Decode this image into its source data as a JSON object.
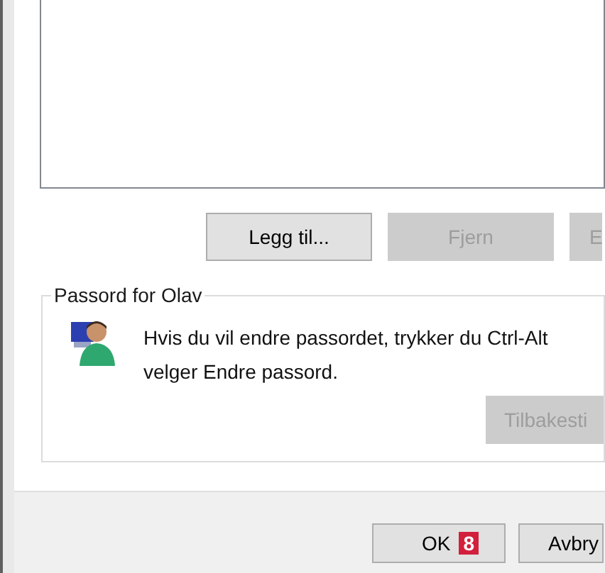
{
  "action_buttons": [
    {
      "label": "Legg til...",
      "disabled": false
    },
    {
      "label": "Fjern",
      "disabled": true
    },
    {
      "label": "E",
      "disabled": true
    }
  ],
  "password_group": {
    "title": "Passord for Olav",
    "lines": [
      "Hvis du vil endre passordet, trykker du Ctrl-Alt",
      "velger Endre passord."
    ],
    "reset_button": {
      "label": "Tilbakesti",
      "disabled": true
    }
  },
  "dialog_buttons": [
    {
      "label": "OK",
      "badge": "8"
    },
    {
      "label": "Avbry"
    }
  ]
}
